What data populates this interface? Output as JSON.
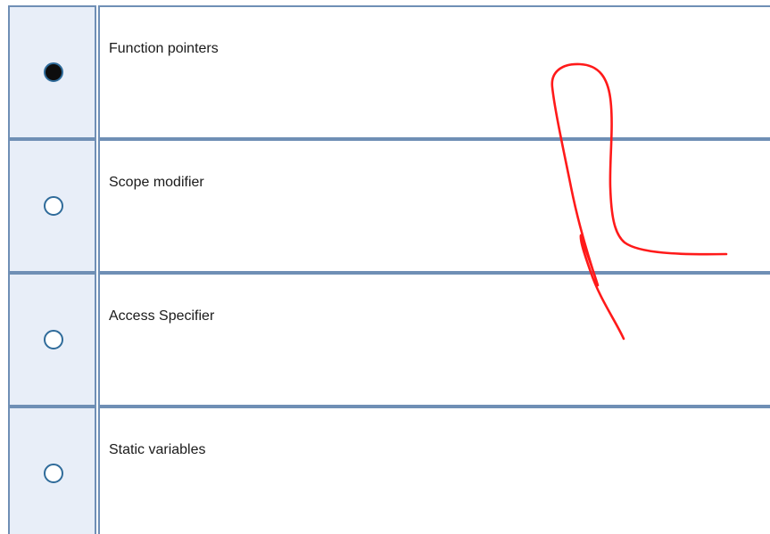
{
  "quiz": {
    "options": [
      {
        "label": "Function pointers",
        "selected": true
      },
      {
        "label": "Scope modifier",
        "selected": false
      },
      {
        "label": "Access Specifier",
        "selected": false
      },
      {
        "label": "Static variables",
        "selected": false
      }
    ]
  },
  "colors": {
    "grid_border": "#6f8fb5",
    "radio_cell_bg": "#e8eef8",
    "radio_ring": "#2f6b9a",
    "radio_fill": "#0d0d0d",
    "annotation_ink": "#ff1a1a"
  }
}
